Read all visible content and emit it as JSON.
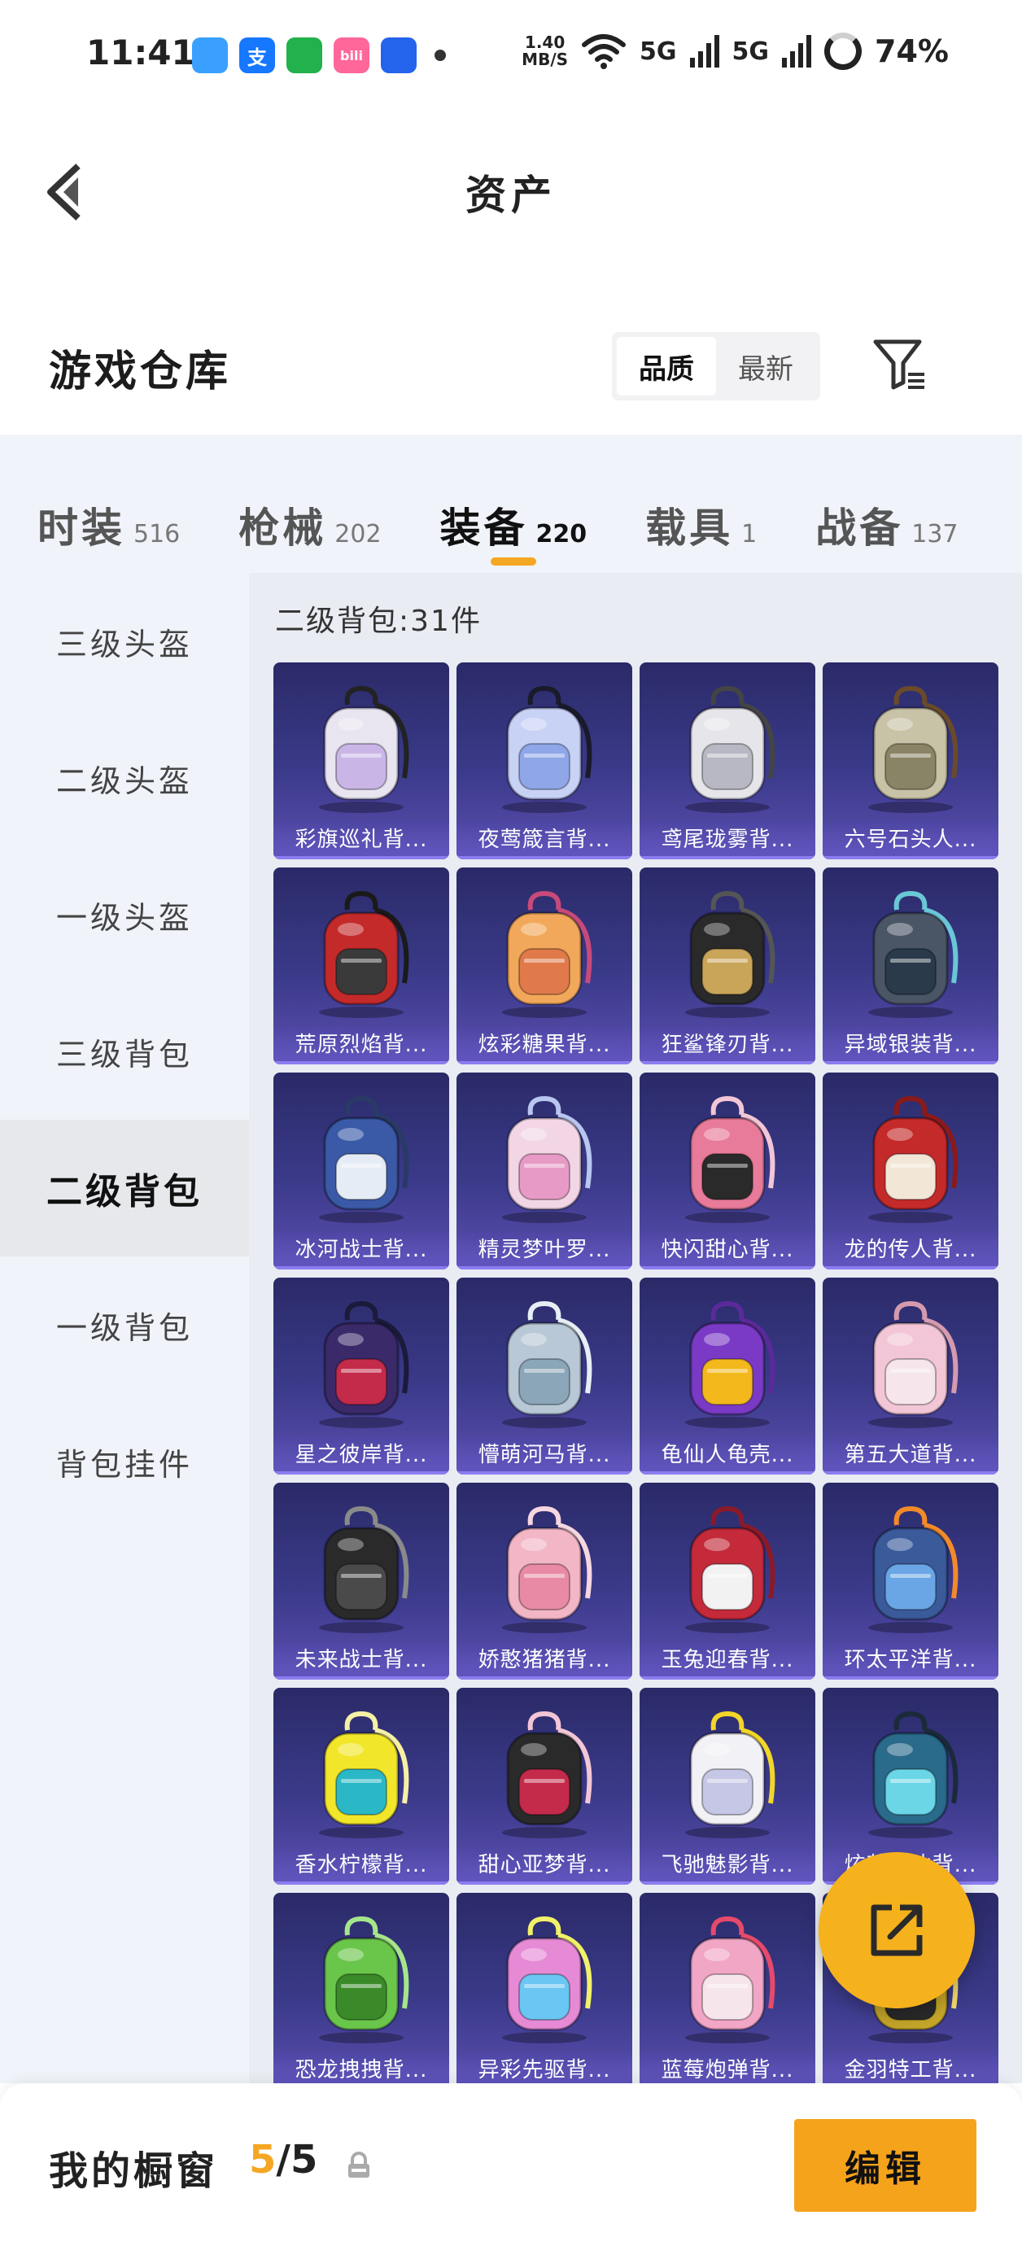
{
  "status": {
    "time": "11:41",
    "net_speed_value": "1.40",
    "net_speed_unit": "MB/S",
    "signal1": "5G",
    "signal2": "5G",
    "battery": "74%",
    "apps": [
      {
        "name": "browser",
        "color": "#3aa0ff"
      },
      {
        "name": "alipay",
        "glyph": "支",
        "color": "#1677ff"
      },
      {
        "name": "shield",
        "color": "#22b14c"
      },
      {
        "name": "bilibili",
        "glyph": "bili",
        "color": "#ff6699"
      },
      {
        "name": "feishu",
        "color": "#2463eb"
      }
    ]
  },
  "header": {
    "title": "资产"
  },
  "warehouse": {
    "title": "游戏仓库",
    "sort_options": [
      "品质",
      "最新"
    ],
    "active_sort": "品质"
  },
  "tabs": [
    {
      "label": "时装",
      "count": "516"
    },
    {
      "label": "枪械",
      "count": "202"
    },
    {
      "label": "装备",
      "count": "220",
      "active": true
    },
    {
      "label": "载具",
      "count": "1"
    },
    {
      "label": "战备",
      "count": "137"
    }
  ],
  "sidebar": {
    "items": [
      {
        "label": "三级头盔"
      },
      {
        "label": "二级头盔"
      },
      {
        "label": "一级头盔"
      },
      {
        "label": "三级背包"
      },
      {
        "label": "二级背包",
        "active": true
      },
      {
        "label": "一级背包"
      },
      {
        "label": "背包挂件"
      }
    ]
  },
  "content": {
    "count_label": "二级背包:31件",
    "items": [
      {
        "name": "彩旗巡礼背...",
        "colors": [
          "#e8e4f0",
          "#c9b6e6",
          "#222"
        ]
      },
      {
        "name": "夜莺箴言背...",
        "colors": [
          "#c7d2f5",
          "#8fa6e8",
          "#1a1a2a"
        ]
      },
      {
        "name": "鸢尾珑雾背...",
        "colors": [
          "#e6e6ea",
          "#b8b8c4",
          "#444"
        ]
      },
      {
        "name": "六号石头人...",
        "colors": [
          "#c8c2a6",
          "#8a8466",
          "#6a4a2a"
        ]
      },
      {
        "name": "荒原烈焰背...",
        "colors": [
          "#c42a2a",
          "#3a3a3a",
          "#1a1a1a"
        ]
      },
      {
        "name": "炫彩糖果背...",
        "colors": [
          "#f2a85a",
          "#e07a4a",
          "#c74a7a"
        ]
      },
      {
        "name": "狂鲨锋刃背...",
        "colors": [
          "#2a2a2a",
          "#c9a55a",
          "#555"
        ]
      },
      {
        "name": "异域银装背...",
        "colors": [
          "#4a5566",
          "#2a3a4a",
          "#6ac7d6"
        ]
      },
      {
        "name": "冰河战士背...",
        "colors": [
          "#3a5aa8",
          "#e6ecf6",
          "#2a3a66"
        ]
      },
      {
        "name": "精灵梦叶罗...",
        "colors": [
          "#f2d6e6",
          "#e89ac6",
          "#b8c6f0"
        ]
      },
      {
        "name": "快闪甜心背...",
        "colors": [
          "#e87a9a",
          "#2a2a2a",
          "#f2c6d6"
        ]
      },
      {
        "name": "龙的传人背...",
        "colors": [
          "#c42a2a",
          "#f2e6d6",
          "#8a1a1a"
        ]
      },
      {
        "name": "星之彼岸背...",
        "colors": [
          "#3a2a6a",
          "#c42a4a",
          "#1a1a3a"
        ]
      },
      {
        "name": "懵萌河马背...",
        "colors": [
          "#b8c8d6",
          "#8aa6b8",
          "#e6eef4"
        ]
      },
      {
        "name": "龟仙人龟壳...",
        "colors": [
          "#7a3ac6",
          "#f2b81c",
          "#5a2a9a"
        ]
      },
      {
        "name": "第五大道背...",
        "colors": [
          "#f2c6d6",
          "#f6e6ec",
          "#d69aae"
        ]
      },
      {
        "name": "未来战士背...",
        "colors": [
          "#2a2a2a",
          "#4a4a4a",
          "#8a8a8a"
        ]
      },
      {
        "name": "娇憨猪猪背...",
        "colors": [
          "#f2b6c6",
          "#e88aa6",
          "#f6d6e0"
        ]
      },
      {
        "name": "玉兔迎春背...",
        "colors": [
          "#c42a3a",
          "#f2f2f2",
          "#8a1a2a"
        ]
      },
      {
        "name": "环太平洋背...",
        "colors": [
          "#3a5a9a",
          "#6aa6e6",
          "#f28a2a"
        ]
      },
      {
        "name": "香水柠檬背...",
        "colors": [
          "#f2e62a",
          "#2ab8c6",
          "#f6f0a6"
        ]
      },
      {
        "name": "甜心亚梦背...",
        "colors": [
          "#2a2a2a",
          "#c42a4a",
          "#f2c6d6"
        ]
      },
      {
        "name": "飞驰魅影背...",
        "colors": [
          "#f2f2f6",
          "#c6c6e6",
          "#f2d62a"
        ]
      },
      {
        "name": "炫若流冰背...",
        "colors": [
          "#2a6a8a",
          "#6ad6e6",
          "#1a2a3a"
        ]
      },
      {
        "name": "恐龙拽拽背...",
        "colors": [
          "#6ac64a",
          "#3a8a2a",
          "#a6e68a"
        ]
      },
      {
        "name": "异彩先驱背...",
        "colors": [
          "#e68ad6",
          "#6ac6f2",
          "#f2f26a"
        ]
      },
      {
        "name": "蓝莓炮弹背...",
        "colors": [
          "#f2a6c6",
          "#f6e6ec",
          "#e64a6a"
        ]
      },
      {
        "name": "金羽特工背...",
        "colors": [
          "#c6a62a",
          "#2a2a2a",
          "#f2d66a"
        ]
      }
    ]
  },
  "footer": {
    "label": "我的橱窗",
    "used": "5",
    "separator": "/",
    "total": "5",
    "edit_label": "编辑"
  },
  "colors": {
    "accent": "#f5a623",
    "card_top": "#2a2a68",
    "card_bottom": "#5a4fb0",
    "tab_bg": "#f0f3f9",
    "content_bg": "#e9ecf2"
  }
}
